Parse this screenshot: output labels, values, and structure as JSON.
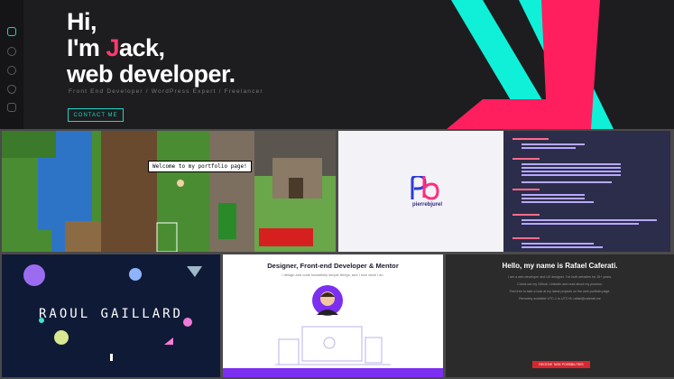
{
  "jack": {
    "line1": "Hi,",
    "line2_pre": "I'm ",
    "line2_j": "J",
    "line2_rest": "ack,",
    "line3": "web developer.",
    "tagline": "Front End Developer / WordPress Expert / Freelancer",
    "cta": "CONTACT ME",
    "colors": {
      "accent": "#ff3a6f",
      "teal": "#22d3c5"
    }
  },
  "game": {
    "speech": "Welcome to my portfolio page!"
  },
  "pb": {
    "brand": "pierrebjurel"
  },
  "raoul": {
    "name": "RAOUL GAILLARD"
  },
  "designer": {
    "title": "Designer, Front-end Developer & Mentor",
    "subtitle": "I design and code beautifully simple things, and I love what I do."
  },
  "rafael": {
    "title": "Hello, my name is Rafael Caferati.",
    "lines": [
      "I am a web developer and UX designer. I've built websites for 15+ years.",
      "Check out my Github, Linkedin and read about my process.",
      "Feel free to take a look at my latest projects on the web portfolio page.",
      "Remotely available UTC-1 to UTC+8: rafael@caferati.me"
    ],
    "cta": "RECEIVE TASK POSSIBILITIES"
  }
}
